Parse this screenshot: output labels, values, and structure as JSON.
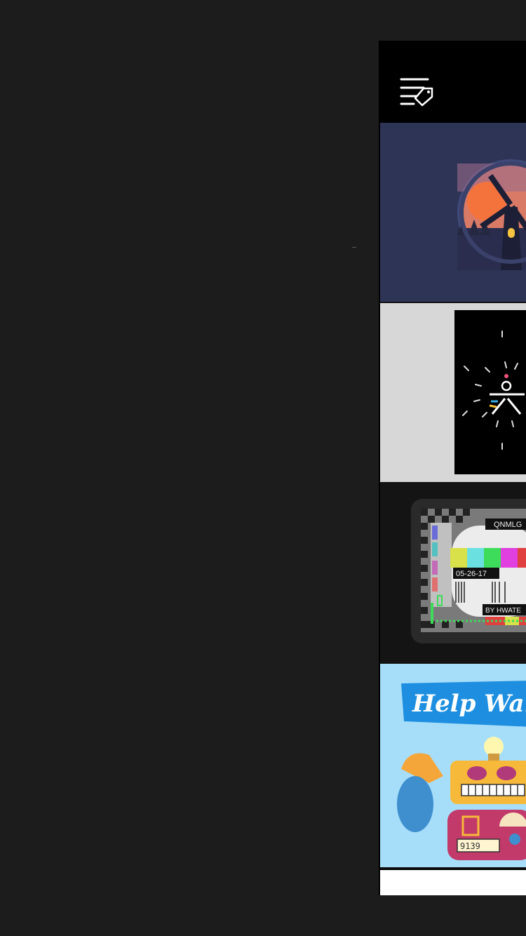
{
  "header": {
    "menu_icon": "tag-menu-icon"
  },
  "colors": {
    "background": "#1c1c1c",
    "panel": "#000000",
    "tile_windmill_bg": "#2e3456",
    "tile_burst_bg": "#d7d7d7",
    "tile_testcard_bg": "#121212",
    "tile_robot_bg": "#a6defa",
    "accent_blue": "#1e8fe0",
    "accent_orange": "#f57f4a"
  },
  "tiles": [
    {
      "icon": "windmill-illustration-icon"
    },
    {
      "icon": "starburst-figure-icon"
    },
    {
      "icon": "tv-test-card-icon",
      "label_top": "QNMLG",
      "date": "05-26-17",
      "byline": "BY HWATE"
    },
    {
      "icon": "robot-illustration-icon",
      "banner": "Help Wan",
      "counter": "9139"
    }
  ]
}
